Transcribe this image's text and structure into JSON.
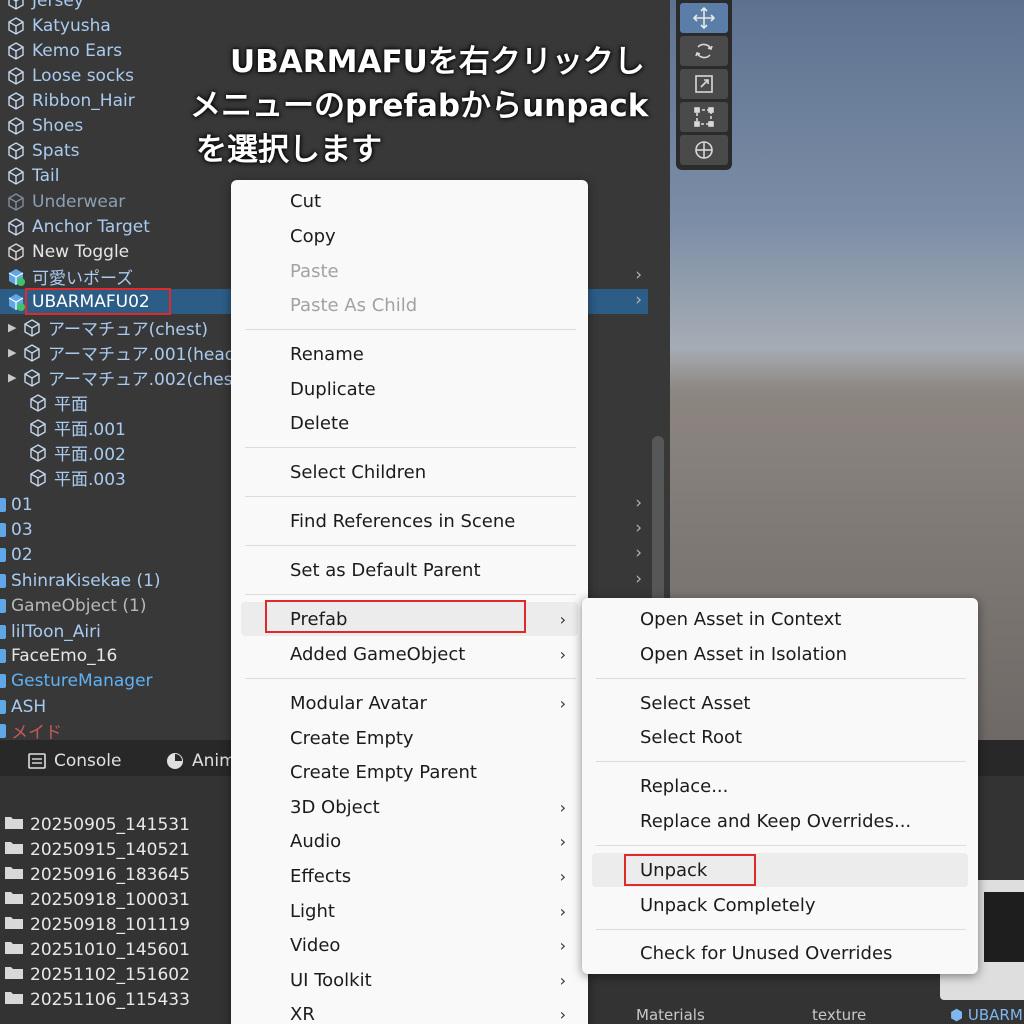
{
  "annotation": {
    "line1": "UBARMAFUを右クリックし",
    "line2": "メニューのprefabからunpack",
    "line3": "を選択します"
  },
  "hierarchy": {
    "rows": [
      {
        "label": "Jersey"
      },
      {
        "label": "Katyusha"
      },
      {
        "label": "Kemo Ears"
      },
      {
        "label": "Loose socks"
      },
      {
        "label": "Ribbon_Hair"
      },
      {
        "label": "Shoes"
      },
      {
        "label": "Spats"
      },
      {
        "label": "Tail"
      },
      {
        "label": "Underwear"
      },
      {
        "label": "Anchor Target"
      },
      {
        "label": "New Toggle"
      },
      {
        "label": "可愛いポーズ"
      },
      {
        "label": "UBARMAFU02"
      },
      {
        "label": "アーマチュア(chest)"
      },
      {
        "label": "アーマチュア.001(head"
      },
      {
        "label": "アーマチュア.002(ches"
      },
      {
        "label": "平面"
      },
      {
        "label": "平面.001"
      },
      {
        "label": "平面.002"
      },
      {
        "label": "平面.003"
      },
      {
        "label": "01"
      },
      {
        "label": "03"
      },
      {
        "label": "02"
      },
      {
        "label": "ShinraKisekae (1)"
      },
      {
        "label": "GameObject (1)"
      },
      {
        "label": "lilToon_Airi"
      },
      {
        "label": "FaceEmo_16"
      },
      {
        "label": "GestureManager"
      },
      {
        "label": "ASH"
      },
      {
        "label": "メイド"
      }
    ]
  },
  "tabs": {
    "console": "Console",
    "animation": "Anim"
  },
  "project": {
    "folders": [
      "20250905_141531",
      "20250915_140521",
      "20250916_183645",
      "20250918_100031",
      "20250918_101119",
      "20251010_145601",
      "20251102_151602",
      "20251106_115433"
    ],
    "assets": {
      "materials": "Materials",
      "texture": "texture",
      "ubar": "UBARM"
    }
  },
  "context_menu": {
    "cut": "Cut",
    "copy": "Copy",
    "paste": "Paste",
    "paste_as_child": "Paste As Child",
    "rename": "Rename",
    "duplicate": "Duplicate",
    "delete": "Delete",
    "select_children": "Select Children",
    "find_references": "Find References in Scene",
    "set_default_parent": "Set as Default Parent",
    "prefab": "Prefab",
    "added_gameobject": "Added GameObject",
    "modular_avatar": "Modular Avatar",
    "create_empty": "Create Empty",
    "create_empty_parent": "Create Empty Parent",
    "object_3d": "3D Object",
    "audio": "Audio",
    "effects": "Effects",
    "light": "Light",
    "video": "Video",
    "ui_toolkit": "UI Toolkit",
    "xr": "XR"
  },
  "prefab_submenu": {
    "open_in_context": "Open Asset in Context",
    "open_in_isolation": "Open Asset in Isolation",
    "select_asset": "Select Asset",
    "select_root": "Select Root",
    "replace": "Replace...",
    "replace_keep": "Replace and Keep Overrides...",
    "unpack": "Unpack",
    "unpack_completely": "Unpack Completely",
    "check_unused": "Check for Unused Overrides"
  },
  "colors": {
    "selection": "#2c5d87",
    "highlight_box": "#e02a2a",
    "menu_bg": "#f9f9f9",
    "prefab_text": "#aacbf0"
  },
  "icons": [
    "cube-icon",
    "prefab-icon",
    "folder-icon",
    "move-tool-icon",
    "rotate-tool-icon",
    "scale-tool-icon",
    "rect-tool-icon",
    "transform-tool-icon",
    "console-icon",
    "animation-icon",
    "chevron-right-icon"
  ]
}
